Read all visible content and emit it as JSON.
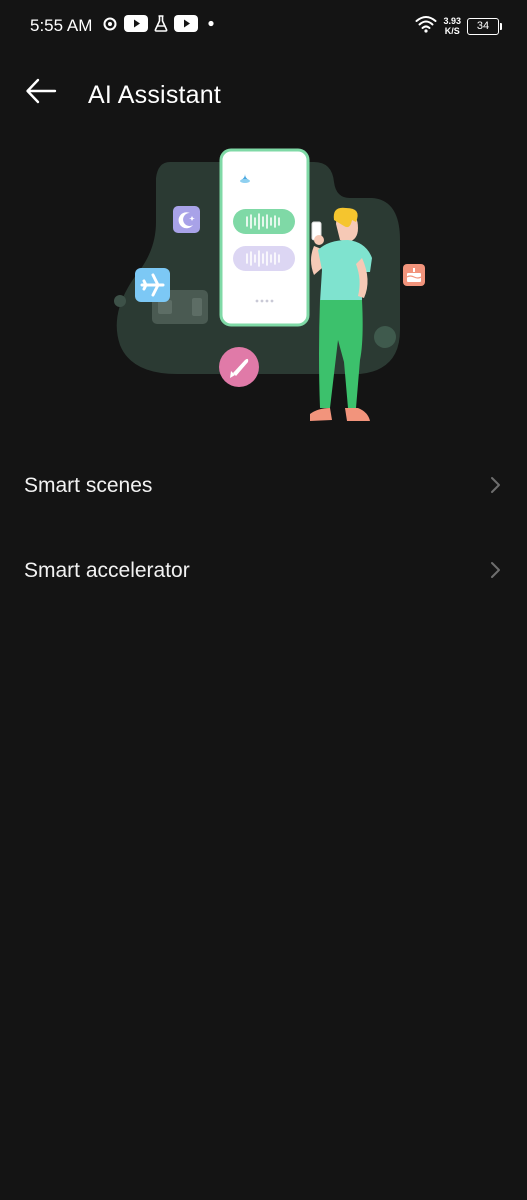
{
  "status_bar": {
    "time": "5:55 AM",
    "net_speed_value": "3.93",
    "net_speed_unit": "K/S",
    "battery": "34",
    "icons": [
      "sync-icon",
      "youtube-icon",
      "flask-icon",
      "youtube-icon",
      "dot-icon",
      "wifi-icon",
      "battery-icon"
    ]
  },
  "header": {
    "title": "AI Assistant",
    "back_icon": "back-arrow-icon"
  },
  "menu": {
    "items": [
      {
        "label": "Smart scenes"
      },
      {
        "label": "Smart accelerator"
      }
    ]
  },
  "colors": {
    "background": "#141414",
    "text": "#ffffff",
    "illustration_blob": "#2b3a33",
    "phone_border": "#7fd9a6",
    "person_shirt": "#7fe3cf",
    "person_pants": "#3cc16c"
  }
}
